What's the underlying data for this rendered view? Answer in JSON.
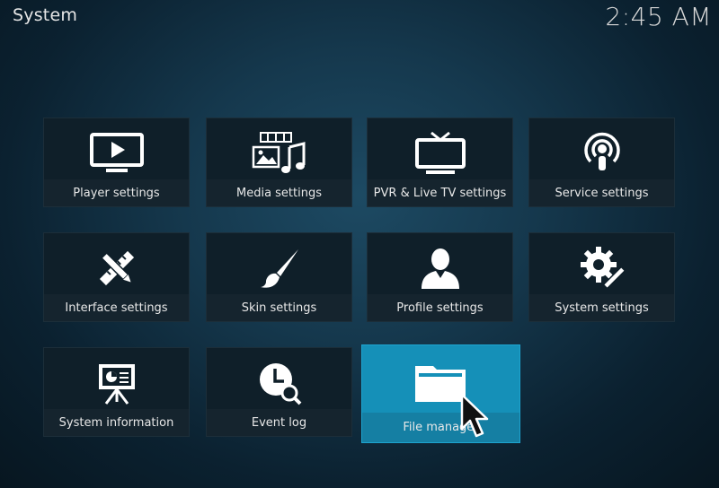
{
  "header": {
    "title": "System",
    "clock": "2:45 AM"
  },
  "tiles": [
    {
      "label": "Player settings",
      "icon": "monitor-play-icon"
    },
    {
      "label": "Media settings",
      "icon": "media-files-icon"
    },
    {
      "label": "PVR & Live TV settings",
      "icon": "tv-antenna-icon"
    },
    {
      "label": "Service settings",
      "icon": "broadcast-icon"
    },
    {
      "label": "Interface settings",
      "icon": "pencil-ruler-icon"
    },
    {
      "label": "Skin settings",
      "icon": "paintbrush-icon"
    },
    {
      "label": "Profile settings",
      "icon": "user-icon"
    },
    {
      "label": "System settings",
      "icon": "gear-wrench-icon"
    },
    {
      "label": "System information",
      "icon": "presentation-board-icon"
    },
    {
      "label": "Event log",
      "icon": "clock-search-icon"
    },
    {
      "label": "File manager",
      "icon": "folder-icon"
    }
  ],
  "colors": {
    "focus": "#1590b8",
    "tile": "#0f1f29"
  }
}
